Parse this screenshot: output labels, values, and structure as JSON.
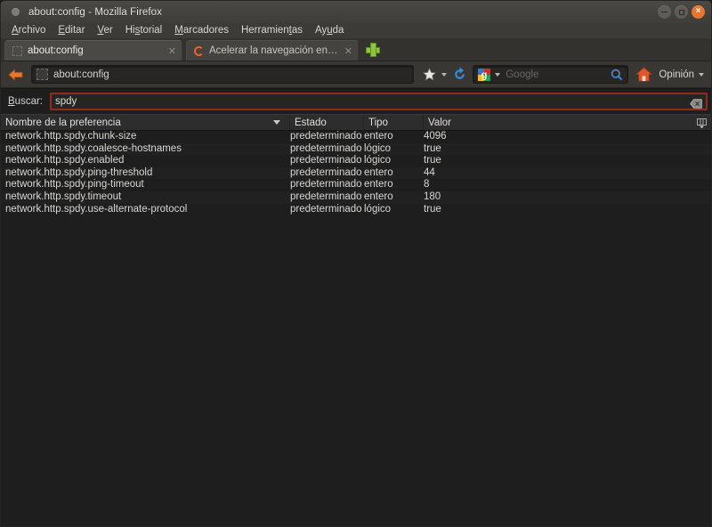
{
  "window": {
    "title": "about:config - Mozilla Firefox",
    "buttons": {
      "minimize": "minimize",
      "maximize": "maximize",
      "close": "×"
    }
  },
  "menubar": {
    "items": [
      {
        "label": "Archivo",
        "mnemonic": "A"
      },
      {
        "label": "Editar",
        "mnemonic": "E"
      },
      {
        "label": "Ver",
        "mnemonic": "V"
      },
      {
        "label": "Historial",
        "mnemonic": "s"
      },
      {
        "label": "Marcadores",
        "mnemonic": "M"
      },
      {
        "label": "Herramientas",
        "mnemonic": "t"
      },
      {
        "label": "Ayuda",
        "mnemonic": "u"
      }
    ]
  },
  "tabs": {
    "items": [
      {
        "label": "about:config",
        "active": true,
        "close": "✕"
      },
      {
        "label": "Acelerar la navegación en Mozill…",
        "active": false,
        "close": "✕"
      }
    ],
    "newtab_label": "+"
  },
  "navbar": {
    "back_label": "Atrás",
    "url": "about:config",
    "bookmark_label": "Marcador",
    "reload_label": "Recargar",
    "search_engine": "Google",
    "search_placeholder": "Google",
    "home_label": "Inicio",
    "feedback_label": "Opinión"
  },
  "filter": {
    "label": "Buscar:",
    "label_mnemonic": "B",
    "value": "spdy",
    "placeholder": "",
    "border_color": "#8f2b20"
  },
  "table": {
    "headers": {
      "name": "Nombre de la preferencia",
      "status": "Estado",
      "type": "Tipo",
      "value": "Valor"
    },
    "rows": [
      {
        "name": "network.http.spdy.chunk-size",
        "status": "predeterminado",
        "type": "entero",
        "value": "4096"
      },
      {
        "name": "network.http.spdy.coalesce-hostnames",
        "status": "predeterminado",
        "type": "lógico",
        "value": "true"
      },
      {
        "name": "network.http.spdy.enabled",
        "status": "predeterminado",
        "type": "lógico",
        "value": "true"
      },
      {
        "name": "network.http.spdy.ping-threshold",
        "status": "predeterminado",
        "type": "entero",
        "value": "44"
      },
      {
        "name": "network.http.spdy.ping-timeout",
        "status": "predeterminado",
        "type": "entero",
        "value": "8"
      },
      {
        "name": "network.http.spdy.timeout",
        "status": "predeterminado",
        "type": "entero",
        "value": "180"
      },
      {
        "name": "network.http.spdy.use-alternate-protocol",
        "status": "predeterminado",
        "type": "lógico",
        "value": "true"
      }
    ]
  },
  "colors": {
    "accent_orange": "#e8762c",
    "filter_border": "#8f2b20",
    "newtab_green": "#8cc63e",
    "reload_blue": "#3b8ed0",
    "titlebar": "#43423e",
    "content_bg": "#1e1e1e"
  }
}
